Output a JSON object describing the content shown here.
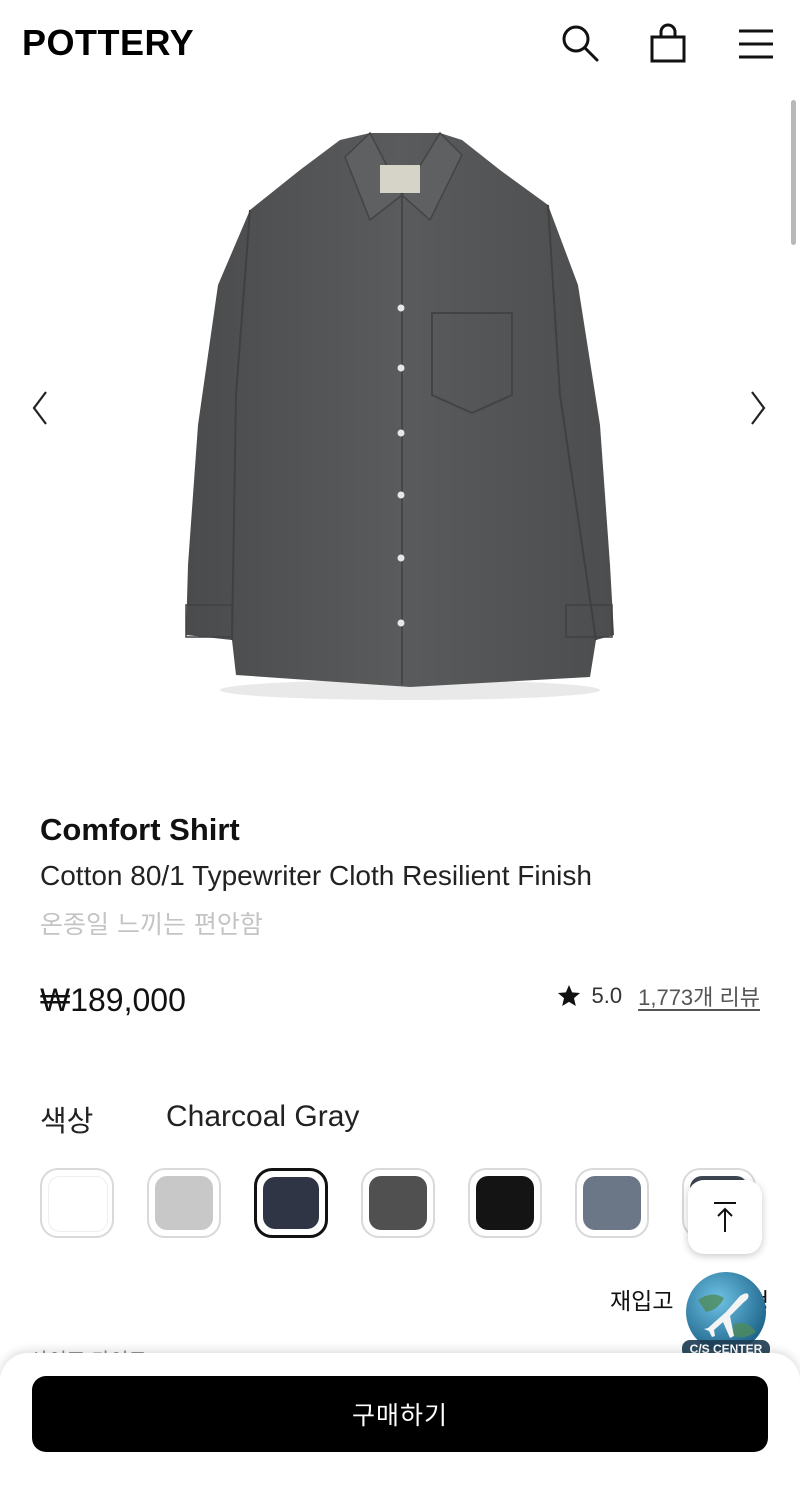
{
  "header": {
    "logo": "POTTERY",
    "icons": [
      "search-icon",
      "bag-icon",
      "menu-icon"
    ]
  },
  "gallery": {
    "prev_label": "〈",
    "next_label": "〉",
    "shirt_color": "#545556"
  },
  "product": {
    "name": "Comfort Shirt",
    "description": "Cotton 80/1 Typewriter Cloth Resilient Finish",
    "subtitle": "온종일 느끼는 편안함",
    "price": "₩189,000",
    "rating": "5.0",
    "reviews": "1,773개 리뷰"
  },
  "color": {
    "label": "색상",
    "selected": "Charcoal Gray",
    "swatches": [
      {
        "color": "#ffffff"
      },
      {
        "color": "#c8c8c8"
      },
      {
        "color": "#2f3545",
        "selected": true
      },
      {
        "color": "#505050"
      },
      {
        "color": "#141414"
      },
      {
        "color": "#6b7686"
      },
      {
        "color": "#3e4653"
      }
    ]
  },
  "floating": {
    "top_icon": "arrow-up-icon",
    "restock_text": "재입고",
    "restock_end": "청",
    "cs_label": "C/S CENTER"
  },
  "bottom_bar": {
    "peek_text": "사이즈 가이드",
    "buy_label": "구매하기"
  }
}
